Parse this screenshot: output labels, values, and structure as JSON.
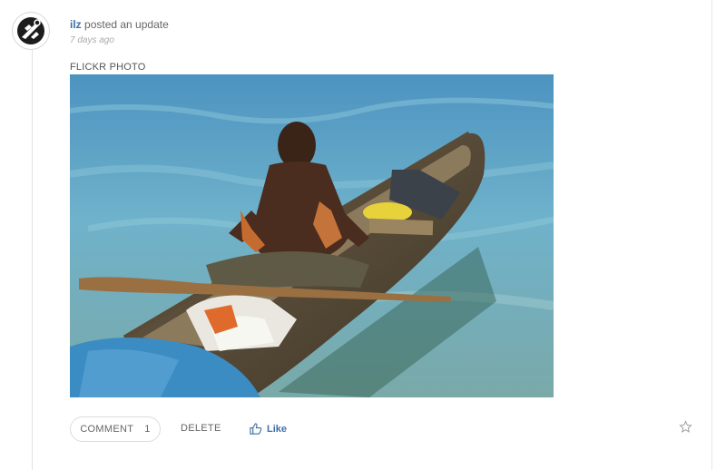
{
  "post": {
    "author": "ilz",
    "action": "posted an update",
    "timestamp": "7 days ago",
    "media_label": "FLICKR PHOTO"
  },
  "photo": {
    "description_icon": "photo-icon"
  },
  "actions": {
    "comment_label": "COMMENT",
    "comment_count": "1",
    "delete_label": "DELETE",
    "like_label": "Like"
  },
  "colors": {
    "link": "#3f6fa8",
    "muted": "#aaaaaa",
    "border": "#dcdcdc"
  },
  "icons": {
    "avatar": "avatar-icon",
    "like": "thumbs-up-icon",
    "favorite": "star-icon"
  }
}
